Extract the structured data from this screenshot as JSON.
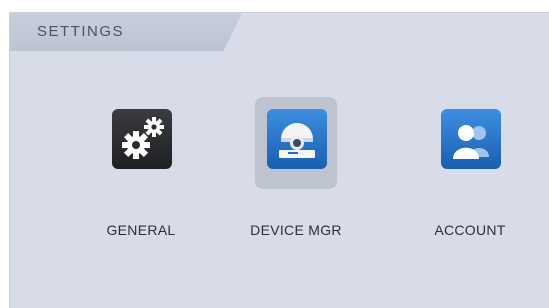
{
  "panel": {
    "title": "SETTINGS"
  },
  "tiles": [
    {
      "label": "GENERAL",
      "icon": "gears-icon",
      "selected": false
    },
    {
      "label": "DEVICE MGR",
      "icon": "camera-icon",
      "selected": true
    },
    {
      "label": "ACCOUNT",
      "icon": "users-icon",
      "selected": false
    }
  ],
  "colors": {
    "panel_bg": "#d7dce8",
    "tab_bg": "#c4cad8",
    "selected_bg": "#bdc3cf",
    "general_icon_bg": "#2e2f33",
    "blue_icon_bg": "#1f6fc2"
  }
}
